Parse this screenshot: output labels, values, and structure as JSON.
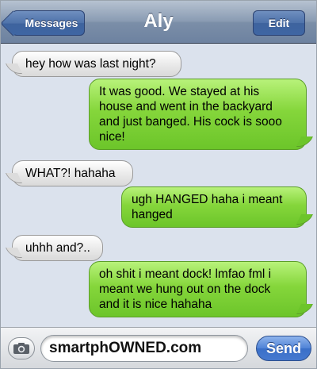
{
  "navbar": {
    "back_label": "Messages",
    "title": "Aly",
    "edit_label": "Edit"
  },
  "messages": [
    {
      "side": "received",
      "text": "hey how was last night?"
    },
    {
      "side": "sent",
      "text": "It was good. We stayed at his house and went in the backyard and just banged. His cock is sooo nice!"
    },
    {
      "side": "received",
      "text": "WHAT?! hahaha"
    },
    {
      "side": "sent",
      "text": "ugh HANGED haha i meant hanged"
    },
    {
      "side": "received",
      "text": "uhhh and?.."
    },
    {
      "side": "sent",
      "text": "oh shit i meant dock! lmfao fml i meant we hung out on the dock and it is nice hahaha"
    }
  ],
  "inputbar": {
    "camera_icon": "camera-icon",
    "input_value": "smartphOWNED.com",
    "send_label": "Send"
  },
  "colors": {
    "sent_bubble": "#85d63b",
    "received_bubble": "#e6e6e6",
    "background": "#dbe2ed",
    "send_button": "#4f82d6"
  }
}
